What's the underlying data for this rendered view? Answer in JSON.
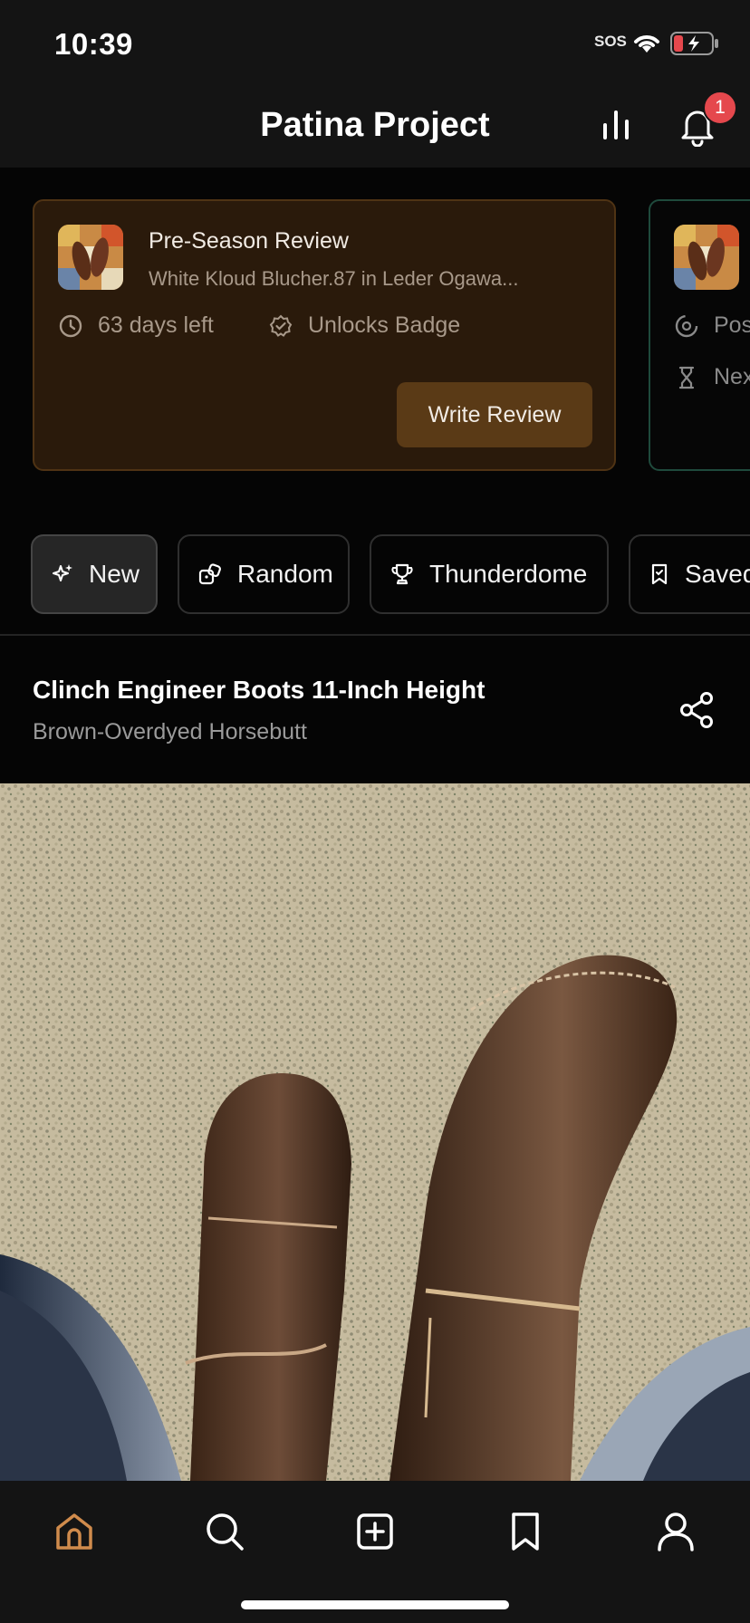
{
  "status": {
    "time": "10:39",
    "sos": "SOS"
  },
  "header": {
    "title": "Patina Project",
    "notification_count": "1"
  },
  "review_card": {
    "title": "Pre-Season Review",
    "subtitle": "White Kloud Blucher.87 in Leder Ogawa...",
    "days_left": "63 days left",
    "unlocks": "Unlocks Badge",
    "button_label": "Write Review"
  },
  "second_card": {
    "row1": "Pos",
    "row2": "Nex"
  },
  "filters": [
    {
      "label": "New",
      "icon": "sparkles-icon",
      "active": true
    },
    {
      "label": "Random",
      "icon": "dice-icon",
      "active": false
    },
    {
      "label": "Thunderdome",
      "icon": "trophy-icon",
      "active": false
    },
    {
      "label": "Saved",
      "icon": "bookmark-icon",
      "active": false
    }
  ],
  "post": {
    "title": "Clinch Engineer Boots 11-Inch Height",
    "subtitle": "Brown-Overdyed Horsebutt"
  },
  "tabs": [
    "home-icon",
    "search-icon",
    "add-icon",
    "bookmark-icon",
    "profile-icon"
  ],
  "colors": {
    "accent": "#d08b4c",
    "card_bg": "#2a1a0b",
    "badge": "#e5484d"
  }
}
